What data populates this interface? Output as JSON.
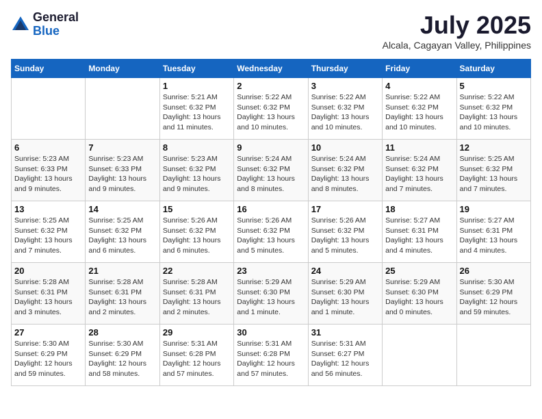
{
  "logo": {
    "general": "General",
    "blue": "Blue"
  },
  "header": {
    "month": "July 2025",
    "location": "Alcala, Cagayan Valley, Philippines"
  },
  "weekdays": [
    "Sunday",
    "Monday",
    "Tuesday",
    "Wednesday",
    "Thursday",
    "Friday",
    "Saturday"
  ],
  "weeks": [
    [
      {
        "day": "",
        "info": ""
      },
      {
        "day": "",
        "info": ""
      },
      {
        "day": "1",
        "info": "Sunrise: 5:21 AM\nSunset: 6:32 PM\nDaylight: 13 hours and 11 minutes."
      },
      {
        "day": "2",
        "info": "Sunrise: 5:22 AM\nSunset: 6:32 PM\nDaylight: 13 hours and 10 minutes."
      },
      {
        "day": "3",
        "info": "Sunrise: 5:22 AM\nSunset: 6:32 PM\nDaylight: 13 hours and 10 minutes."
      },
      {
        "day": "4",
        "info": "Sunrise: 5:22 AM\nSunset: 6:32 PM\nDaylight: 13 hours and 10 minutes."
      },
      {
        "day": "5",
        "info": "Sunrise: 5:22 AM\nSunset: 6:32 PM\nDaylight: 13 hours and 10 minutes."
      }
    ],
    [
      {
        "day": "6",
        "info": "Sunrise: 5:23 AM\nSunset: 6:33 PM\nDaylight: 13 hours and 9 minutes."
      },
      {
        "day": "7",
        "info": "Sunrise: 5:23 AM\nSunset: 6:33 PM\nDaylight: 13 hours and 9 minutes."
      },
      {
        "day": "8",
        "info": "Sunrise: 5:23 AM\nSunset: 6:32 PM\nDaylight: 13 hours and 9 minutes."
      },
      {
        "day": "9",
        "info": "Sunrise: 5:24 AM\nSunset: 6:32 PM\nDaylight: 13 hours and 8 minutes."
      },
      {
        "day": "10",
        "info": "Sunrise: 5:24 AM\nSunset: 6:32 PM\nDaylight: 13 hours and 8 minutes."
      },
      {
        "day": "11",
        "info": "Sunrise: 5:24 AM\nSunset: 6:32 PM\nDaylight: 13 hours and 7 minutes."
      },
      {
        "day": "12",
        "info": "Sunrise: 5:25 AM\nSunset: 6:32 PM\nDaylight: 13 hours and 7 minutes."
      }
    ],
    [
      {
        "day": "13",
        "info": "Sunrise: 5:25 AM\nSunset: 6:32 PM\nDaylight: 13 hours and 7 minutes."
      },
      {
        "day": "14",
        "info": "Sunrise: 5:25 AM\nSunset: 6:32 PM\nDaylight: 13 hours and 6 minutes."
      },
      {
        "day": "15",
        "info": "Sunrise: 5:26 AM\nSunset: 6:32 PM\nDaylight: 13 hours and 6 minutes."
      },
      {
        "day": "16",
        "info": "Sunrise: 5:26 AM\nSunset: 6:32 PM\nDaylight: 13 hours and 5 minutes."
      },
      {
        "day": "17",
        "info": "Sunrise: 5:26 AM\nSunset: 6:32 PM\nDaylight: 13 hours and 5 minutes."
      },
      {
        "day": "18",
        "info": "Sunrise: 5:27 AM\nSunset: 6:31 PM\nDaylight: 13 hours and 4 minutes."
      },
      {
        "day": "19",
        "info": "Sunrise: 5:27 AM\nSunset: 6:31 PM\nDaylight: 13 hours and 4 minutes."
      }
    ],
    [
      {
        "day": "20",
        "info": "Sunrise: 5:28 AM\nSunset: 6:31 PM\nDaylight: 13 hours and 3 minutes."
      },
      {
        "day": "21",
        "info": "Sunrise: 5:28 AM\nSunset: 6:31 PM\nDaylight: 13 hours and 2 minutes."
      },
      {
        "day": "22",
        "info": "Sunrise: 5:28 AM\nSunset: 6:31 PM\nDaylight: 13 hours and 2 minutes."
      },
      {
        "day": "23",
        "info": "Sunrise: 5:29 AM\nSunset: 6:30 PM\nDaylight: 13 hours and 1 minute."
      },
      {
        "day": "24",
        "info": "Sunrise: 5:29 AM\nSunset: 6:30 PM\nDaylight: 13 hours and 1 minute."
      },
      {
        "day": "25",
        "info": "Sunrise: 5:29 AM\nSunset: 6:30 PM\nDaylight: 13 hours and 0 minutes."
      },
      {
        "day": "26",
        "info": "Sunrise: 5:30 AM\nSunset: 6:29 PM\nDaylight: 12 hours and 59 minutes."
      }
    ],
    [
      {
        "day": "27",
        "info": "Sunrise: 5:30 AM\nSunset: 6:29 PM\nDaylight: 12 hours and 59 minutes."
      },
      {
        "day": "28",
        "info": "Sunrise: 5:30 AM\nSunset: 6:29 PM\nDaylight: 12 hours and 58 minutes."
      },
      {
        "day": "29",
        "info": "Sunrise: 5:31 AM\nSunset: 6:28 PM\nDaylight: 12 hours and 57 minutes."
      },
      {
        "day": "30",
        "info": "Sunrise: 5:31 AM\nSunset: 6:28 PM\nDaylight: 12 hours and 57 minutes."
      },
      {
        "day": "31",
        "info": "Sunrise: 5:31 AM\nSunset: 6:27 PM\nDaylight: 12 hours and 56 minutes."
      },
      {
        "day": "",
        "info": ""
      },
      {
        "day": "",
        "info": ""
      }
    ]
  ]
}
